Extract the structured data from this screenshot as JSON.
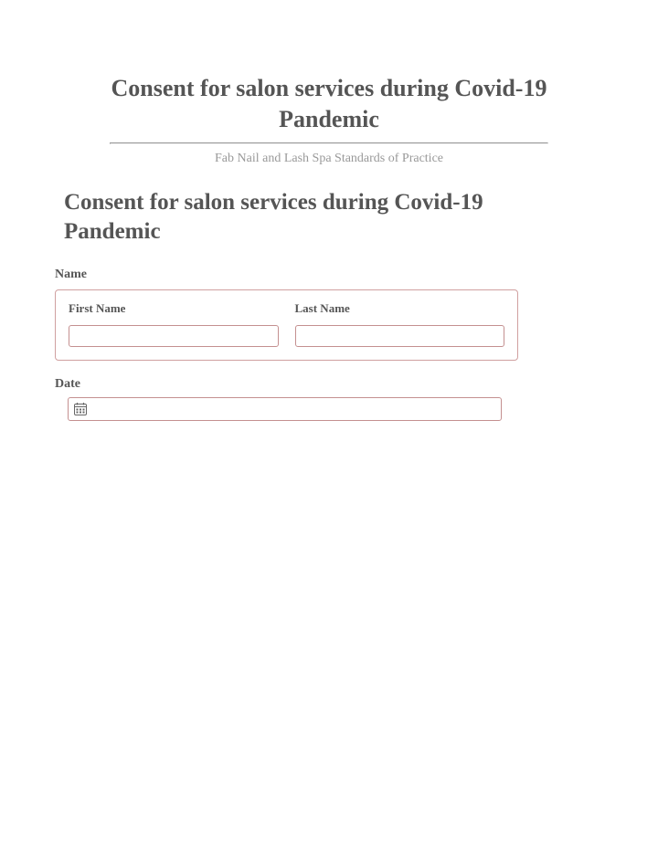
{
  "header": {
    "title": "Consent for salon services during Covid-19 Pandemic",
    "subtitle": "Fab Nail and Lash Spa Standards of Practice"
  },
  "form": {
    "heading": "Consent for salon services during Covid-19 Pandemic",
    "name": {
      "group_label": "Name",
      "first_label": "First Name",
      "first_value": "",
      "last_label": "Last Name",
      "last_value": ""
    },
    "date": {
      "label": "Date",
      "value": ""
    }
  }
}
